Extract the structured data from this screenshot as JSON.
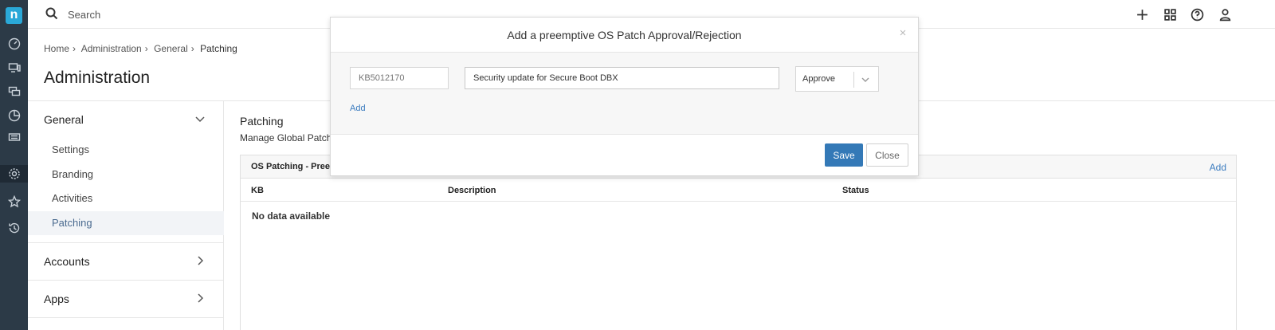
{
  "app": {
    "logo_letter": "n"
  },
  "topbar": {
    "search_placeholder": "Search"
  },
  "breadcrumb": [
    "Home",
    "Administration",
    "General",
    "Patching"
  ],
  "page_title": "Administration",
  "sidebar": {
    "sections": [
      {
        "label": "General",
        "items": [
          "Settings",
          "Branding",
          "Activities",
          "Patching"
        ],
        "active_item": "Patching"
      },
      {
        "label": "Accounts"
      },
      {
        "label": "Apps"
      }
    ]
  },
  "content": {
    "title": "Patching",
    "subtitle": "Manage Global Patching",
    "panel": {
      "title": "OS Patching - Preemptive",
      "add_label": "Add",
      "columns": [
        "KB",
        "Description",
        "Status"
      ],
      "empty_text": "No data available"
    }
  },
  "modal": {
    "title": "Add a preemptive OS Patch Approval/Rejection",
    "close_glyph": "×",
    "kb_placeholder": "KB5012170",
    "description_value": "Security update for Secure Boot DBX",
    "status_value": "Approve",
    "add_label": "Add",
    "save_label": "Save",
    "close_label": "Close"
  },
  "colors": {
    "rail": "#2c3a47",
    "logo": "#2aa8d8",
    "primary": "#3479b7",
    "link": "#3a7bbf"
  }
}
